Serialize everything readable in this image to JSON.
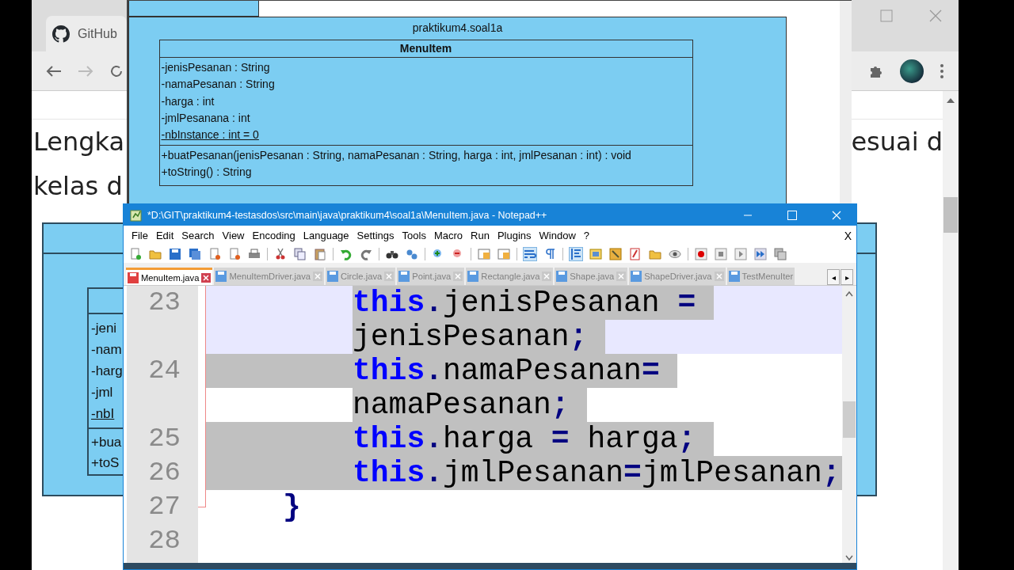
{
  "browser": {
    "tab": {
      "title": "GitHub",
      "selected": true
    },
    "page": {
      "paragraph_left": [
        "Lengka",
        "kelas d"
      ],
      "paragraph_right": "esuai d",
      "diagram": {
        "attributes": [
          {
            "text": "-jeni",
            "static": false
          },
          {
            "text": "-nam",
            "static": false
          },
          {
            "text": "-harg",
            "static": false
          },
          {
            "text": "-jml",
            "static": false
          },
          {
            "text": "-nbI",
            "static": true
          }
        ],
        "methods": [
          "+bua",
          "+toS"
        ]
      }
    }
  },
  "diagram_window": {
    "package": "praktikum4.soal1a",
    "class_name": "MenuItem",
    "attributes": [
      {
        "text": "-jenisPesanan : String",
        "static": false
      },
      {
        "text": "-namaPesanan : String",
        "static": false
      },
      {
        "text": "-harga : int",
        "static": false
      },
      {
        "text": "-jmlPesanana : int",
        "static": false
      },
      {
        "text": "-nbInstance : int = 0",
        "static": true
      }
    ],
    "methods": [
      "+buatPesanan(jenisPesanan : String, namaPesanan : String, harga : int, jmlPesanan : int) : void",
      "+toString() : String"
    ]
  },
  "editor_window": {
    "title": "*D:\\GIT\\praktikum4-testasdos\\src\\main\\java\\praktikum4\\soal1a\\MenuItem.java - Notepad++",
    "menu": [
      "File",
      "Edit",
      "Search",
      "View",
      "Encoding",
      "Language",
      "Settings",
      "Tools",
      "Macro",
      "Run",
      "Plugins",
      "Window",
      "?"
    ],
    "menu_close": "X",
    "toolbar": [
      {
        "buttons": [
          {
            "kind": "new",
            "pressed": false
          },
          {
            "kind": "open",
            "pressed": false
          },
          {
            "kind": "save",
            "pressed": false
          },
          {
            "kind": "save-all",
            "pressed": false
          },
          {
            "kind": "close",
            "pressed": false
          },
          {
            "kind": "close-all",
            "pressed": false
          },
          {
            "kind": "print",
            "pressed": false
          }
        ]
      },
      {
        "buttons": [
          {
            "kind": "cut",
            "pressed": false
          },
          {
            "kind": "copy",
            "pressed": false
          },
          {
            "kind": "paste",
            "pressed": false
          }
        ]
      },
      {
        "buttons": [
          {
            "kind": "undo",
            "pressed": false
          },
          {
            "kind": "redo",
            "pressed": false
          }
        ]
      },
      {
        "buttons": [
          {
            "kind": "find",
            "pressed": false
          },
          {
            "kind": "replace",
            "pressed": false
          }
        ]
      },
      {
        "buttons": [
          {
            "kind": "zoom-in",
            "pressed": false
          },
          {
            "kind": "zoom-out",
            "pressed": false
          }
        ]
      },
      {
        "buttons": [
          {
            "kind": "sync-v",
            "pressed": false
          },
          {
            "kind": "sync-h",
            "pressed": false
          }
        ]
      },
      {
        "buttons": [
          {
            "kind": "wrap",
            "pressed": true
          },
          {
            "kind": "pilcrow",
            "pressed": false
          }
        ]
      },
      {
        "buttons": [
          {
            "kind": "indent-guide",
            "pressed": true
          },
          {
            "kind": "language",
            "pressed": false
          },
          {
            "kind": "doc-map",
            "pressed": false
          },
          {
            "kind": "function-list",
            "pressed": false
          },
          {
            "kind": "folder",
            "pressed": false
          },
          {
            "kind": "eye",
            "pressed": false
          }
        ]
      },
      {
        "buttons": [
          {
            "kind": "record",
            "pressed": false
          },
          {
            "kind": "stop",
            "pressed": false
          },
          {
            "kind": "play",
            "pressed": false
          },
          {
            "kind": "play-many",
            "pressed": false
          },
          {
            "kind": "save-macro",
            "pressed": false
          }
        ]
      }
    ],
    "tabs": [
      {
        "label": "MenuItem.java",
        "selected": true
      },
      {
        "label": "MenuItemDriver.java",
        "selected": false
      },
      {
        "label": "Circle.java",
        "selected": false
      },
      {
        "label": "Point.java",
        "selected": false
      },
      {
        "label": "Rectangle.java",
        "selected": false
      },
      {
        "label": "Shape.java",
        "selected": false
      },
      {
        "label": "ShapeDriver.java",
        "selected": false
      },
      {
        "label": "TestMenuIter",
        "selected": false
      }
    ],
    "tab_scroll": [
      "◂",
      "▸"
    ],
    "lines": [
      {
        "number": "23",
        "kind": "body",
        "current": true,
        "selected": true,
        "rows": [
          {
            "tokens": [
              {
                "kind": "keyword",
                "text": "this"
              },
              {
                "kind": "operator",
                "text": "."
              },
              {
                "kind": "plain",
                "text": "jenisPesanan "
              },
              {
                "kind": "operator",
                "text": "="
              }
            ]
          },
          {
            "tokens": [
              {
                "kind": "plain",
                "text": "jenisPesanan"
              },
              {
                "kind": "operator",
                "text": ";"
              }
            ]
          }
        ]
      },
      {
        "number": "24",
        "kind": "body",
        "current": false,
        "selected": true,
        "rows": [
          {
            "tokens": [
              {
                "kind": "keyword",
                "text": "this"
              },
              {
                "kind": "operator",
                "text": "."
              },
              {
                "kind": "plain",
                "text": "namaPesanan"
              },
              {
                "kind": "operator",
                "text": "="
              }
            ]
          },
          {
            "tokens": [
              {
                "kind": "plain",
                "text": "namaPesanan"
              },
              {
                "kind": "operator",
                "text": ";"
              }
            ]
          }
        ]
      },
      {
        "number": "25",
        "kind": "body",
        "current": false,
        "selected": true,
        "rows": [
          {
            "tokens": [
              {
                "kind": "keyword",
                "text": "this"
              },
              {
                "kind": "operator",
                "text": "."
              },
              {
                "kind": "plain",
                "text": "harga "
              },
              {
                "kind": "operator",
                "text": "="
              },
              {
                "kind": "plain",
                "text": " harga"
              },
              {
                "kind": "operator",
                "text": ";"
              }
            ]
          }
        ]
      },
      {
        "number": "26",
        "kind": "body",
        "current": false,
        "selected": true,
        "rows": [
          {
            "tokens": [
              {
                "kind": "keyword",
                "text": "this"
              },
              {
                "kind": "operator",
                "text": "."
              },
              {
                "kind": "plain",
                "text": "jmlPesanan"
              },
              {
                "kind": "operator",
                "text": "="
              },
              {
                "kind": "plain",
                "text": "jmlPesanan"
              },
              {
                "kind": "operator",
                "text": ";"
              }
            ]
          }
        ]
      },
      {
        "number": "27",
        "kind": "brace",
        "current": false,
        "selected": false,
        "rows": [
          {
            "tokens": [
              {
                "kind": "brace",
                "text": "}"
              }
            ]
          }
        ]
      },
      {
        "number": "28",
        "kind": "blank"
      }
    ]
  }
}
